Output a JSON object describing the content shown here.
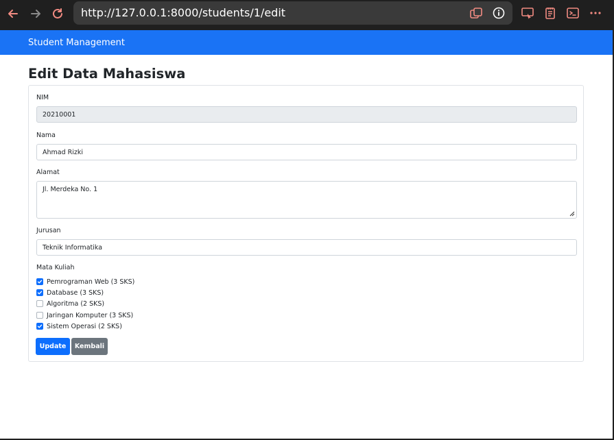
{
  "browser": {
    "url": "http://127.0.0.1:8000/students/1/edit",
    "icons": [
      "back-arrow-icon",
      "forward-arrow-icon",
      "reload-icon",
      "tab-switch-icon",
      "info-icon",
      "screen-cast-icon",
      "notes-icon",
      "terminal-icon",
      "more-icon"
    ]
  },
  "navbar": {
    "brand": "Student Management"
  },
  "page": {
    "title": "Edit Data Mahasiswa"
  },
  "form": {
    "nim": {
      "label": "NIM",
      "value": "20210001"
    },
    "nama": {
      "label": "Nama",
      "value": "Ahmad Rizki"
    },
    "alamat": {
      "label": "Alamat",
      "value": "Jl. Merdeka No. 1"
    },
    "jurusan": {
      "label": "Jurusan",
      "value": "Teknik Informatika"
    },
    "mata_kuliah": {
      "label": "Mata Kuliah",
      "options": [
        {
          "label": "Pemrograman Web (3 SKS)",
          "checked": true
        },
        {
          "label": "Database (3 SKS)",
          "checked": true
        },
        {
          "label": "Algoritma (2 SKS)",
          "checked": false
        },
        {
          "label": "Jaringan Komputer (3 SKS)",
          "checked": false
        },
        {
          "label": "Sistem Operasi (2 SKS)",
          "checked": true
        }
      ]
    },
    "update_label": "Update",
    "back_label": "Kembali"
  },
  "colors": {
    "primary": "#0d6efd",
    "secondary": "#6c757d",
    "navbar": "#1a73f5",
    "icon_accent": "#f28b82"
  }
}
